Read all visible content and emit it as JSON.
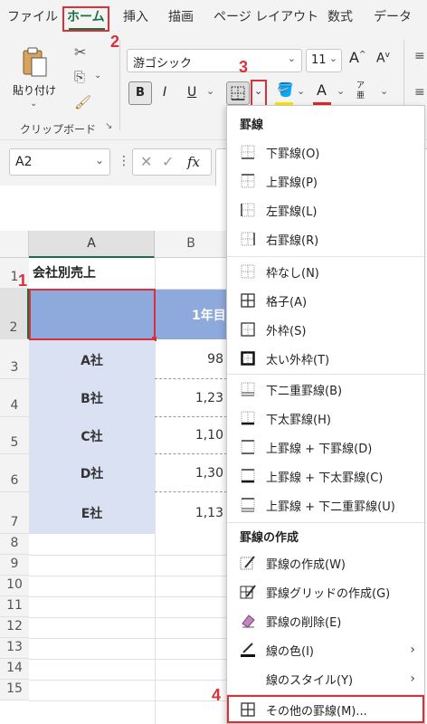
{
  "tabs": [
    {
      "label": "ファイル"
    },
    {
      "label": "ホーム"
    },
    {
      "label": "挿入"
    },
    {
      "label": "描画"
    },
    {
      "label": "ページ レイアウト"
    },
    {
      "label": "数式"
    },
    {
      "label": "データ"
    }
  ],
  "ribbon": {
    "paste_label": "貼り付け",
    "clipboard_group": "クリップボード",
    "font_name": "游ゴシック",
    "font_size": "11",
    "bold": "B",
    "italic": "I",
    "underline": "U",
    "grow_font": "A",
    "shrink_font": "A",
    "font_color_letter": "A",
    "font_color": "#e0262b",
    "fill_color": "#ffe100",
    "phonetic": "ア亜"
  },
  "formula_bar": {
    "name_box": "A2",
    "fx": "fx"
  },
  "sheet": {
    "col_a": "A",
    "col_b": "B",
    "rows": [
      "1",
      "2",
      "3",
      "4",
      "5",
      "6",
      "7",
      "8",
      "9",
      "10",
      "11",
      "12",
      "13",
      "14",
      "15"
    ],
    "title": "会社別売上",
    "header_b": "1年目",
    "companies": [
      "A社",
      "B社",
      "C社",
      "D社",
      "E社"
    ],
    "values_b": [
      "98",
      "1,23",
      "1,10",
      "1,30",
      "1,13"
    ],
    "header_color": "#8ea9db",
    "company_color": "#d9e1f2"
  },
  "menu": {
    "section1": "罫線",
    "items1": [
      "下罫線(O)",
      "上罫線(P)",
      "左罫線(L)",
      "右罫線(R)",
      "枠なし(N)",
      "格子(A)",
      "外枠(S)",
      "太い外枠(T)",
      "下二重罫線(B)",
      "下太罫線(H)",
      "上罫線 + 下罫線(D)",
      "上罫線 + 下太罫線(C)",
      "上罫線 + 下二重罫線(U)"
    ],
    "section2": "罫線の作成",
    "items2": [
      "罫線の作成(W)",
      "罫線グリッドの作成(G)",
      "罫線の削除(E)",
      "線の色(I)",
      "線のスタイル(Y)"
    ],
    "more": "その他の罫線(M)..."
  },
  "annotations": [
    "1",
    "2",
    "3",
    "4"
  ],
  "accent_red": "#d9303a"
}
